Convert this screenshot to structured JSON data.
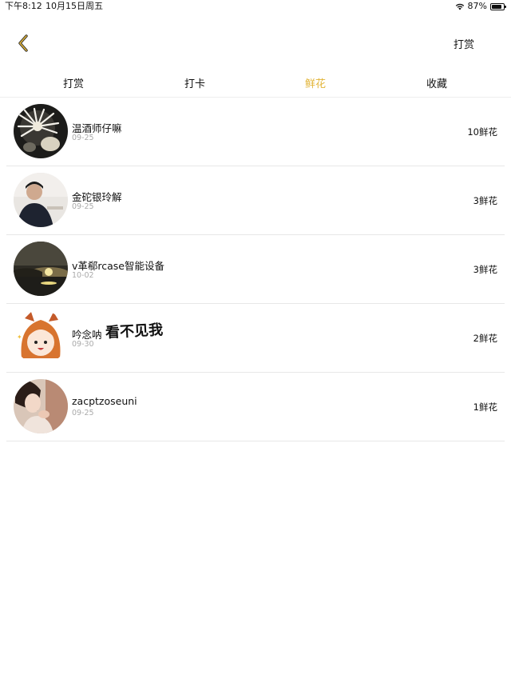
{
  "status_bar": {
    "time": "下午8:12",
    "date": "10月15日周五",
    "battery": "87%",
    "battery_level": 0.87
  },
  "nav": {
    "back_icon": "chevron-left-icon",
    "action_label": "打赏"
  },
  "tabs": [
    {
      "label": "打赏",
      "active": false
    },
    {
      "label": "打卡",
      "active": false
    },
    {
      "label": "鲜花",
      "active": true
    },
    {
      "label": "收藏",
      "active": false
    }
  ],
  "colors": {
    "accent": "#e2b437",
    "divider": "#e7e7e7",
    "date_text": "#aaaaaa"
  },
  "list": [
    {
      "name": "温酒师仔嘛",
      "date": "09-25",
      "count": "10鲜花"
    },
    {
      "name": "金砣银玲解",
      "date": "09-25",
      "count": "3鲜花"
    },
    {
      "name": "v革郗rcase智能设备",
      "date": "10-02",
      "count": "3鲜花"
    },
    {
      "name": "吟念呐",
      "date": "09-30",
      "count": "2鲜花",
      "sticker": "看不见我"
    },
    {
      "name": "zacptzoseuni",
      "date": "09-25",
      "count": "1鲜花"
    }
  ]
}
